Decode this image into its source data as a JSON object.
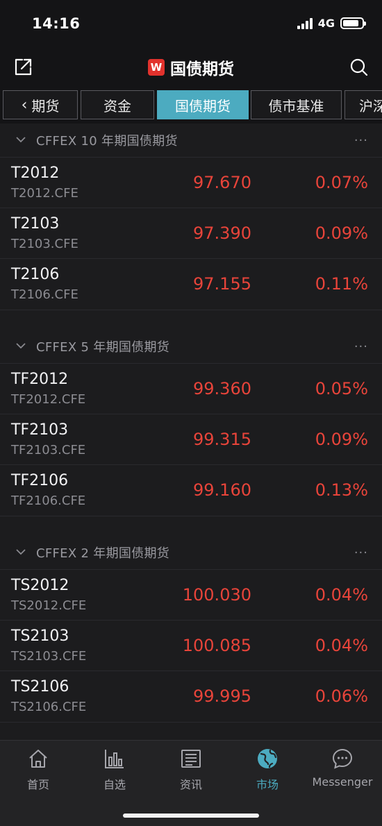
{
  "status_bar": {
    "time": "14:16",
    "network": "4G"
  },
  "header": {
    "logo_letter": "W",
    "title": "国债期货"
  },
  "tabs": [
    {
      "label": "期货"
    },
    {
      "label": "资金"
    },
    {
      "label": "国债期货"
    },
    {
      "label": "债市基准"
    },
    {
      "label": "沪深"
    }
  ],
  "sections": [
    {
      "title": "CFFEX 10 年期国债期货",
      "more": "···",
      "rows": [
        {
          "name": "T2012",
          "code": "T2012.CFE",
          "price": "97.670",
          "change": "0.07%"
        },
        {
          "name": "T2103",
          "code": "T2103.CFE",
          "price": "97.390",
          "change": "0.09%"
        },
        {
          "name": "T2106",
          "code": "T2106.CFE",
          "price": "97.155",
          "change": "0.11%"
        }
      ]
    },
    {
      "title": "CFFEX 5 年期国债期货",
      "more": "···",
      "rows": [
        {
          "name": "TF2012",
          "code": "TF2012.CFE",
          "price": "99.360",
          "change": "0.05%"
        },
        {
          "name": "TF2103",
          "code": "TF2103.CFE",
          "price": "99.315",
          "change": "0.09%"
        },
        {
          "name": "TF2106",
          "code": "TF2106.CFE",
          "price": "99.160",
          "change": "0.13%"
        }
      ]
    },
    {
      "title": "CFFEX 2 年期国债期货",
      "more": "···",
      "rows": [
        {
          "name": "TS2012",
          "code": "TS2012.CFE",
          "price": "100.030",
          "change": "0.04%"
        },
        {
          "name": "TS2103",
          "code": "TS2103.CFE",
          "price": "100.085",
          "change": "0.04%"
        },
        {
          "name": "TS2106",
          "code": "TS2106.CFE",
          "price": "99.995",
          "change": "0.06%"
        }
      ]
    }
  ],
  "nav": [
    {
      "label": "首页",
      "icon": "home-icon"
    },
    {
      "label": "自选",
      "icon": "watchlist-chart-icon"
    },
    {
      "label": "资讯",
      "icon": "news-icon"
    },
    {
      "label": "市场",
      "icon": "market-globe-icon"
    },
    {
      "label": "Messenger",
      "icon": "messenger-icon"
    }
  ],
  "colors": {
    "accent": "#4cabc0",
    "up": "#e8443a",
    "brand": "#e2322d"
  }
}
